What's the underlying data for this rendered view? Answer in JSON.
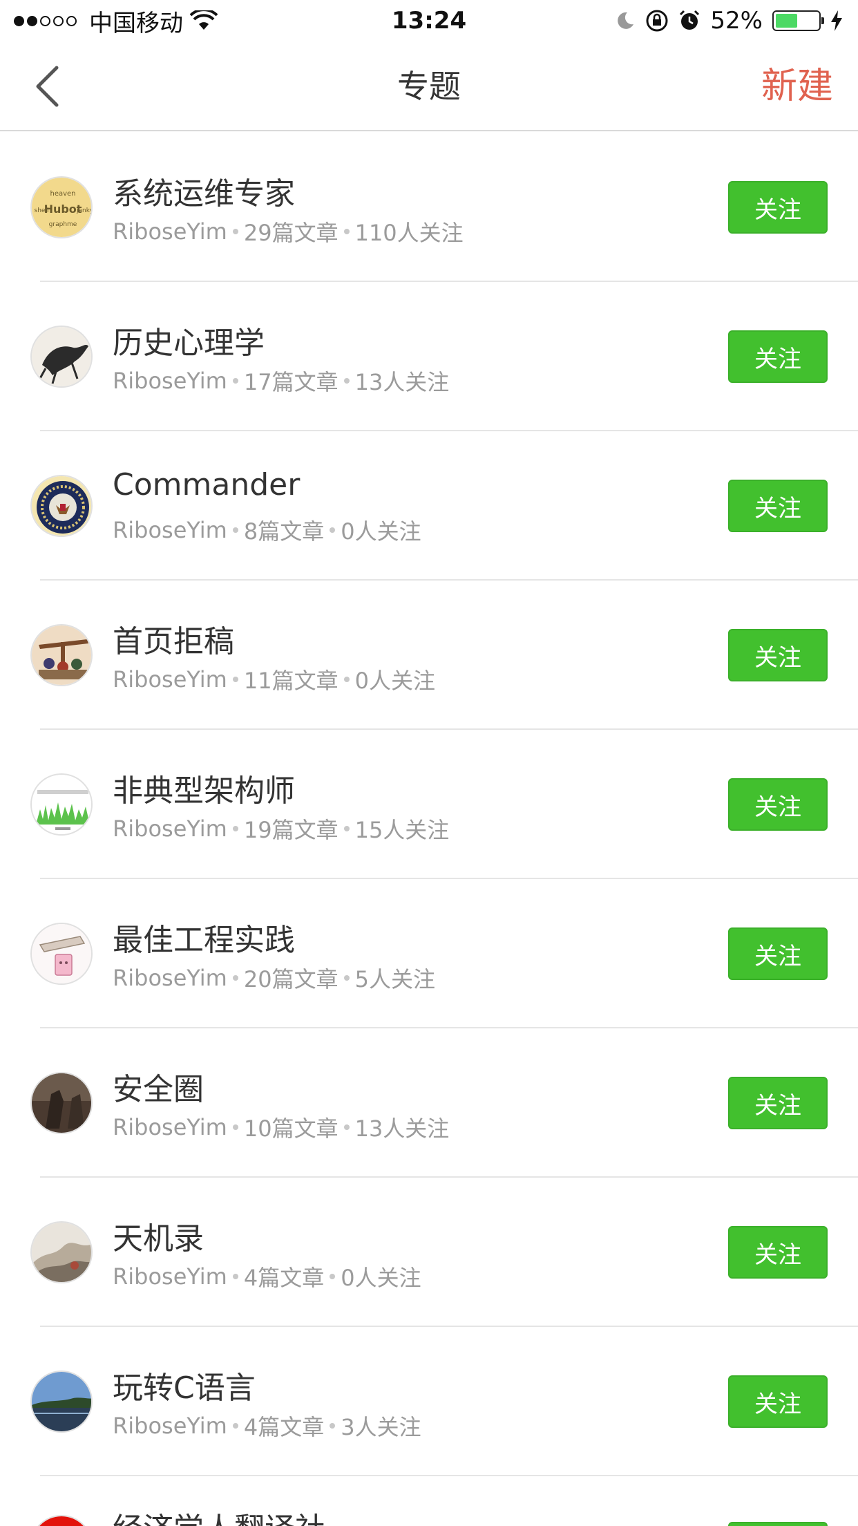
{
  "status_bar": {
    "carrier": "中国移动",
    "time": "13:24",
    "battery": "52%",
    "battery_level": 0.52
  },
  "nav": {
    "title": "专题",
    "new_label": "新建"
  },
  "collections": [
    {
      "title": "系统运维专家",
      "author": "RiboseYim",
      "articles": "29篇文章",
      "followers": "110人关注",
      "button": "关注"
    },
    {
      "title": "历史心理学",
      "author": "RiboseYim",
      "articles": "17篇文章",
      "followers": "13人关注",
      "button": "关注"
    },
    {
      "title": "Commander",
      "author": "RiboseYim",
      "articles": "8篇文章",
      "followers": "0人关注",
      "button": "关注"
    },
    {
      "title": "首页拒稿",
      "author": "RiboseYim",
      "articles": "11篇文章",
      "followers": "0人关注",
      "button": "关注"
    },
    {
      "title": "非典型架构师",
      "author": "RiboseYim",
      "articles": "19篇文章",
      "followers": "15人关注",
      "button": "关注"
    },
    {
      "title": "最佳工程实践",
      "author": "RiboseYim",
      "articles": "20篇文章",
      "followers": "5人关注",
      "button": "关注"
    },
    {
      "title": "安全圈",
      "author": "RiboseYim",
      "articles": "10篇文章",
      "followers": "13人关注",
      "button": "关注"
    },
    {
      "title": "天机录",
      "author": "RiboseYim",
      "articles": "4篇文章",
      "followers": "0人关注",
      "button": "关注"
    },
    {
      "title": "玩转C语言",
      "author": "RiboseYim",
      "articles": "4篇文章",
      "followers": "3人关注",
      "button": "关注"
    }
  ],
  "partial_row": {
    "title": "经济学人翻译社"
  },
  "colors": {
    "accent_red": "#e0624f",
    "follow_green": "#42c02e"
  }
}
